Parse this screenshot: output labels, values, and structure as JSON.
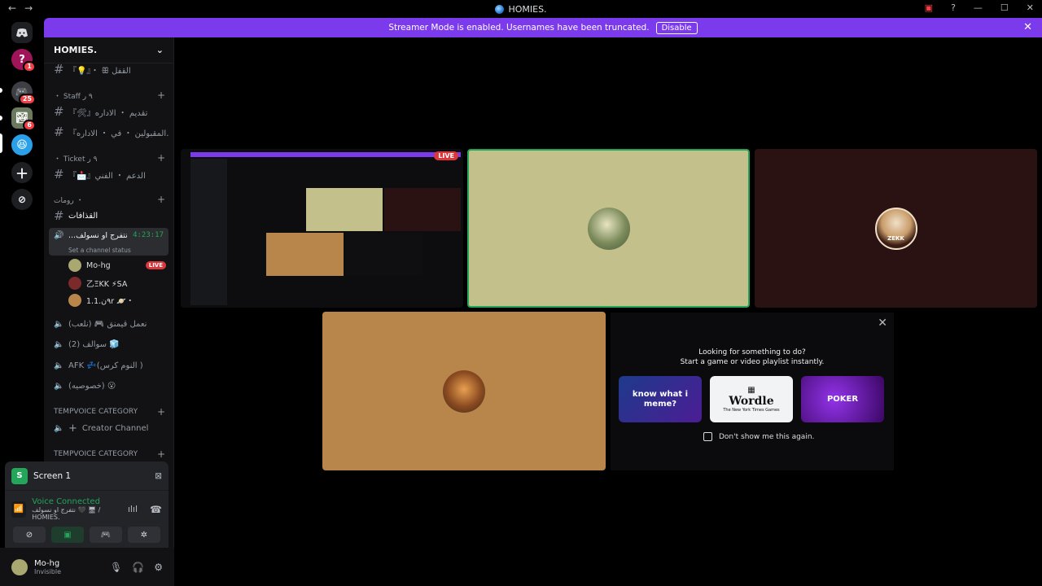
{
  "titlebar": {
    "title": "HOMIES."
  },
  "banner": {
    "text": "Streamer Mode is enabled. Usernames have been truncated.",
    "disable_label": "Disable"
  },
  "guilds": {
    "badges": [
      "1",
      "25",
      "6"
    ]
  },
  "server": {
    "name": "HOMIES."
  },
  "channels": {
    "c1": "『💡』・ ꕥ القفل",
    "cat_staff": "・ Staff ٩ ر",
    "c2": "『🛠』تقديم ・ الاداره",
    "c3": "『المقبولين ・ في ・ الاداره…",
    "cat_ticket": "・ Ticket ٩ ر",
    "c4": "『📩』الدعم ・ الفني",
    "cat_rooms": "رومات ・",
    "c5": "القذافات",
    "vc_active": "...نتفرج او نسولف",
    "vc_timer": "4:23:17",
    "vc_status": "Set a channel status",
    "c6": "نعمل قيمنق 🎮 (نلعب)",
    "c7": "(2) سوالف 🧊",
    "c8": "AFK 💤(النوم كرس )",
    "c9": "(خصوصيه) 😮",
    "cat_temp1": "TEMPVOICE CATEGORY",
    "creator": "Creator Channel",
    "cat_temp2": "TEMPVOICE CATEGORY"
  },
  "voice_users": [
    {
      "name": "Mo-hg",
      "live": "LIVE"
    },
    {
      "name": "乙ΞKK ⚡SA"
    },
    {
      "name": "٩ن.1.1r 🪐・"
    }
  ],
  "panel": {
    "screen": "Screen 1",
    "voice_connected": "Voice Connected",
    "voice_location": "نتفرج او نسولف 🖤 🖥 / HOMIES."
  },
  "user": {
    "name": "Mo-hg",
    "status": "Invisible"
  },
  "stage": {
    "live_label": "LIVE",
    "zekk_label": "ZEKK"
  },
  "suggest": {
    "line1": "Looking for something to do?",
    "line2": "Start a game or video playlist instantly.",
    "cards": [
      "know what i meme?",
      "Wordle",
      "POKER"
    ],
    "wordle_sub": "The New York Times Games",
    "checkbox": "Don't show me this again."
  }
}
